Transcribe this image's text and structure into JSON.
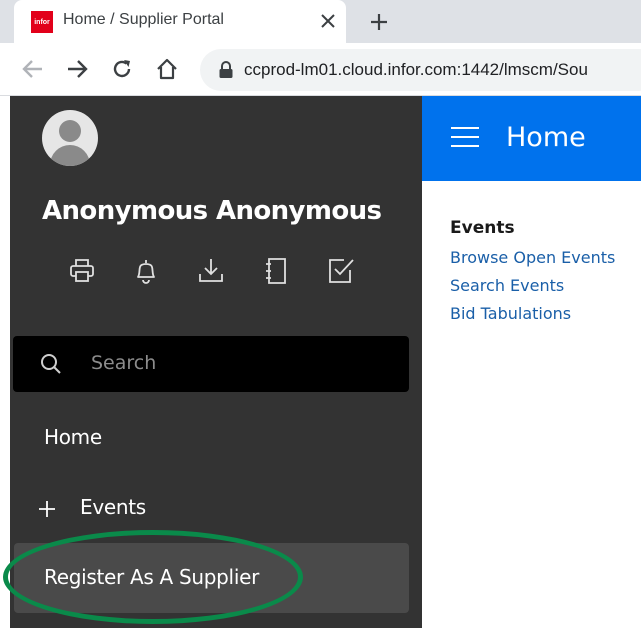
{
  "browser": {
    "tab": {
      "favicon_text": "infor",
      "title": "Home / Supplier Portal",
      "close_icon": "close-icon"
    },
    "new_tab_icon": "plus-icon",
    "nav": {
      "back_icon": "arrow-left-icon",
      "forward_icon": "arrow-right-icon",
      "reload_icon": "reload-icon",
      "home_icon": "home-icon"
    },
    "address_bar": {
      "lock_icon": "lock-icon",
      "url": "ccprod-lm01.cloud.infor.com:1442/lmscm/Sou"
    }
  },
  "sidebar": {
    "user_name": "Anonymous Anonymous",
    "tool_icons": [
      "print-icon",
      "bell-icon",
      "download-icon",
      "bookmark-icon",
      "checkbox-icon"
    ],
    "search": {
      "placeholder": "Search"
    },
    "nav_items": [
      {
        "label": "Home"
      },
      {
        "label": "Events",
        "expand_icon": "plus-icon"
      },
      {
        "label": "Register As A Supplier",
        "selected": true
      }
    ]
  },
  "header": {
    "title": "Home",
    "menu_icon": "hamburger-icon"
  },
  "main": {
    "section_title": "Events",
    "links": [
      {
        "label": "Browse Open Events"
      },
      {
        "label": "Search Events"
      },
      {
        "label": "Bid Tabulations"
      }
    ]
  },
  "colors": {
    "sidebar_bg": "#333333",
    "header_bg": "#0072ed",
    "link": "#1a5fa8",
    "highlight_ring": "#0a8a4a"
  }
}
